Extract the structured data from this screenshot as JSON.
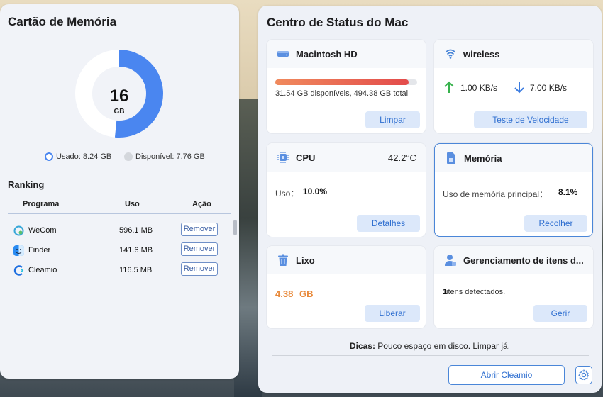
{
  "memory_card": {
    "title": "Cartão de Memória",
    "donut": {
      "value": "16",
      "unit": "GB",
      "used_fraction": 0.515
    },
    "legend": {
      "used": "Usado: 8.24 GB",
      "available": "Disponível: 7.76 GB"
    },
    "ranking": {
      "title": "Ranking",
      "columns": [
        "Programa",
        "Uso",
        "Ação"
      ],
      "rows": [
        {
          "app": "WeCom",
          "usage": "596.1 MB",
          "action": "Remover",
          "icon": "wecom-icon"
        },
        {
          "app": "Finder",
          "usage": "141.6 MB",
          "action": "Remover",
          "icon": "finder-icon"
        },
        {
          "app": "Cleamio",
          "usage": "116.5 MB",
          "action": "Remover",
          "icon": "cleamio-icon"
        }
      ]
    }
  },
  "status_center": {
    "title": "Centro de Status do Mac",
    "disk": {
      "title": "Macintosh HD",
      "usage_fraction": 0.94,
      "info": "31.54 GB disponíveis, 494.38 GB total",
      "button": "Limpar"
    },
    "wireless": {
      "title": "wireless",
      "upload": "1.00 KB/s",
      "download": "7.00 KB/s",
      "button": "Teste de Velocidade"
    },
    "cpu": {
      "title": "CPU",
      "temperature": "42.2°C",
      "usage_label": "Uso：",
      "usage_value": "10.0%",
      "button": "Detalhes"
    },
    "memory": {
      "title": "Memória",
      "usage_label": "Uso de memória principal：",
      "usage_value": "8.1%",
      "button": "Recolher"
    },
    "trash": {
      "title": "Lixo",
      "value": "4.38",
      "unit": "GB",
      "button": "Liberar"
    },
    "items": {
      "title": "Gerenciamento de itens d...",
      "count": "1",
      "count_label": " itens detectados.",
      "button": "Gerir"
    },
    "tips": {
      "label": "Dicas:",
      "text": " Pouco espaço em disco. Limpar já."
    },
    "open_button": "Abrir Cleamio"
  },
  "colors": {
    "accent": "#4a86d8",
    "donut_used": "#4a86f0",
    "trash_value": "#e8893a"
  }
}
